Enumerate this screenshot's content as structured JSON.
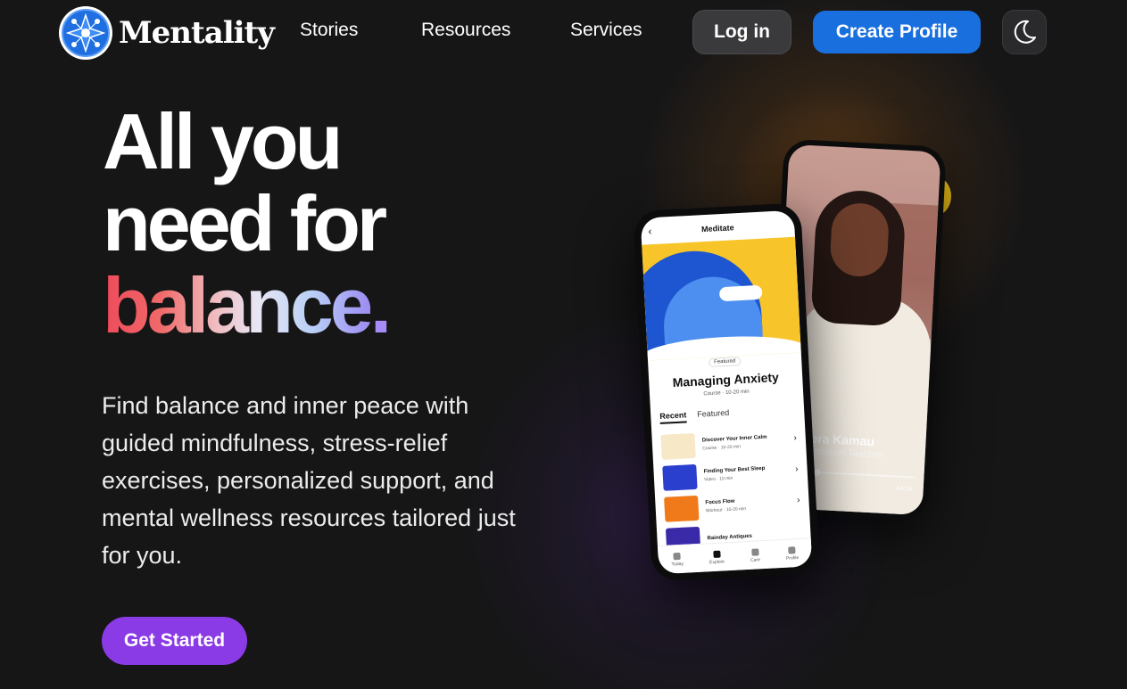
{
  "nav": {
    "brand": "Mentality",
    "links": [
      "Stories",
      "Resources",
      "Services"
    ],
    "login_label": "Log in",
    "create_label": "Create Profile",
    "theme_icon": "moon-icon",
    "logo_icon": "network-star-icon"
  },
  "hero": {
    "title_line1": "All you",
    "title_line2": "need for",
    "title_highlight": "balance",
    "title_dot": ".",
    "description": "Find balance and inner peace with guided mindfulness, stress-relief exercises, personalized support, and mental wellness resources tailored just for you.",
    "cta_label": "Get Started"
  },
  "colors": {
    "background": "#161617",
    "primary_blue": "#1a6fde",
    "cta_purple": "#8b3be6",
    "gradient": [
      "#ef4a5a",
      "#f0bcc0",
      "#e8e6f4",
      "#9c8cf2"
    ]
  },
  "phone_back": {
    "name": "Dora Kamau",
    "role": "Meditation Teacher",
    "duration": "04:34",
    "progress": 0.15
  },
  "phone_front": {
    "screen_title": "Meditate",
    "badge": "Featured",
    "course_title": "Managing Anxiety",
    "course_meta": "Course · 10-20 min",
    "tabs": [
      "Recent",
      "Featured"
    ],
    "items": [
      {
        "title": "Discover Your Inner Calm",
        "meta": "Course · 10-20 min",
        "color": "#f7e8c8"
      },
      {
        "title": "Finding Your Best Sleep",
        "meta": "Video · 10 min",
        "color": "#2b3fcf"
      },
      {
        "title": "Focus Flow",
        "meta": "Workout · 10-20 min",
        "color": "#f07a1a"
      },
      {
        "title": "Rainday Antiques",
        "meta": "",
        "color": "#3a2aa8"
      }
    ],
    "bottom_nav": [
      "Today",
      "Explore",
      "Care",
      "Profile"
    ]
  }
}
